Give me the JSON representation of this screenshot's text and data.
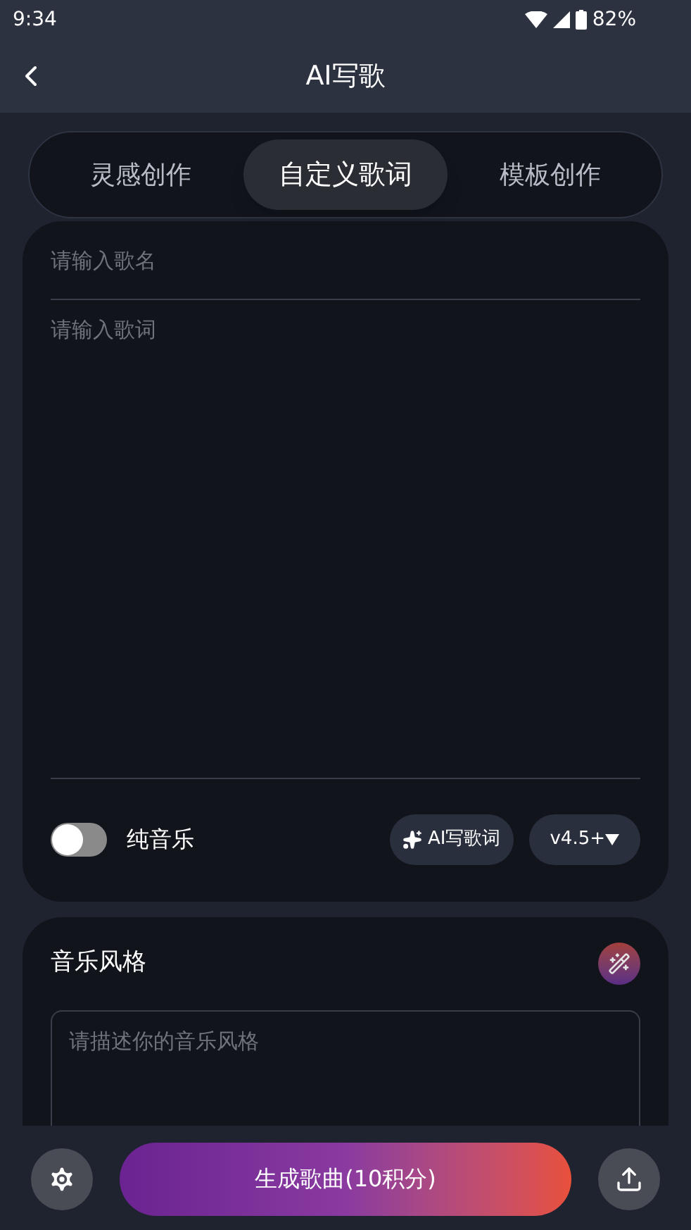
{
  "status_bar": {
    "time": "9:34",
    "battery": "82%"
  },
  "header": {
    "title": "AI写歌"
  },
  "tabs": [
    {
      "label": "灵感创作",
      "selected": false
    },
    {
      "label": "自定义歌词",
      "selected": true
    },
    {
      "label": "模板创作",
      "selected": false
    }
  ],
  "lyrics_card": {
    "title_placeholder": "请输入歌名",
    "lyrics_placeholder": "请输入歌词",
    "instrumental": {
      "label": "纯音乐",
      "on": false
    },
    "ai_lyrics_button": "AI写歌词",
    "version": "v4.5+"
  },
  "style_card": {
    "title": "音乐风格",
    "placeholder": "请描述你的音乐风格"
  },
  "bottom_bar": {
    "generate_button": "生成歌曲(10积分)"
  }
}
